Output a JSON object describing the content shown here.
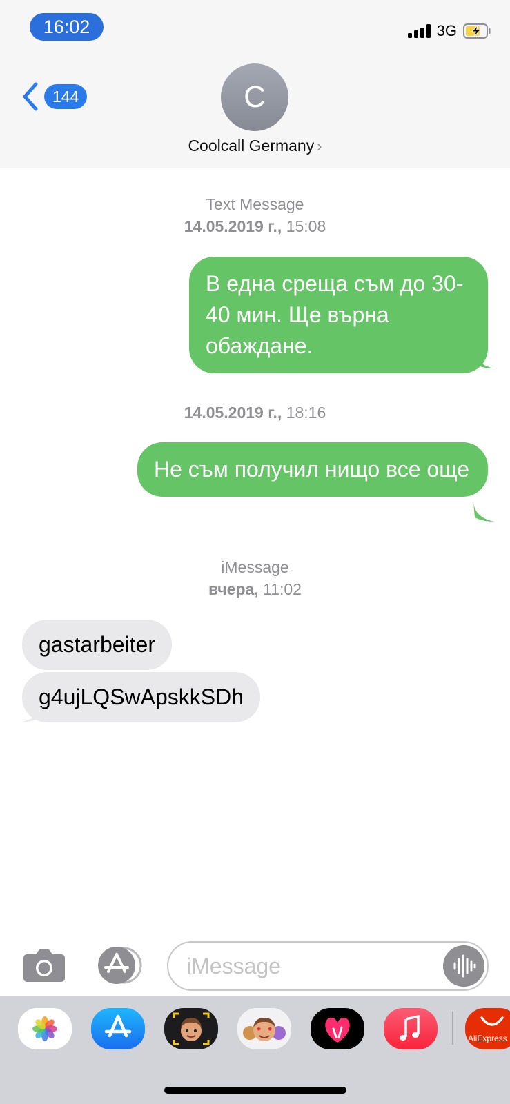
{
  "status_bar": {
    "time": "16:02",
    "network": "3G"
  },
  "nav": {
    "back_count": "144",
    "avatar_initial": "C",
    "contact_name": "Coolcall Germany",
    "contact_chevron": "›"
  },
  "conversation": {
    "group1": {
      "service": "Text Message",
      "timestamp_date": "14.05.2019 г.,",
      "timestamp_time": "15:08"
    },
    "msg1": "В една среща съм до 30-40 мин. Ще върна обаждане.",
    "group2": {
      "timestamp_date": "14.05.2019 г.,",
      "timestamp_time": "18:16"
    },
    "msg2": "Не съм получил нищо все още",
    "group3": {
      "service": "iMessage",
      "timestamp_day": "вчера,",
      "timestamp_time": "11:02"
    },
    "msg3": "gastarbeiter",
    "msg4": "g4ujLQSwApskkSDh"
  },
  "input": {
    "placeholder": "iMessage"
  },
  "drawer": {
    "apps": [
      {
        "icon": "photos-icon"
      },
      {
        "icon": "app-store-icon"
      },
      {
        "icon": "memoji-camera-icon"
      },
      {
        "icon": "memoji-stickers-icon"
      },
      {
        "icon": "digital-touch-icon"
      },
      {
        "icon": "music-icon"
      },
      {
        "label": "AliExpress",
        "icon": "aliexpress-icon"
      }
    ]
  },
  "colors": {
    "sent_bubble": "#65c466",
    "received_bubble": "#e9e9eb",
    "accent": "#2a7ae9"
  }
}
